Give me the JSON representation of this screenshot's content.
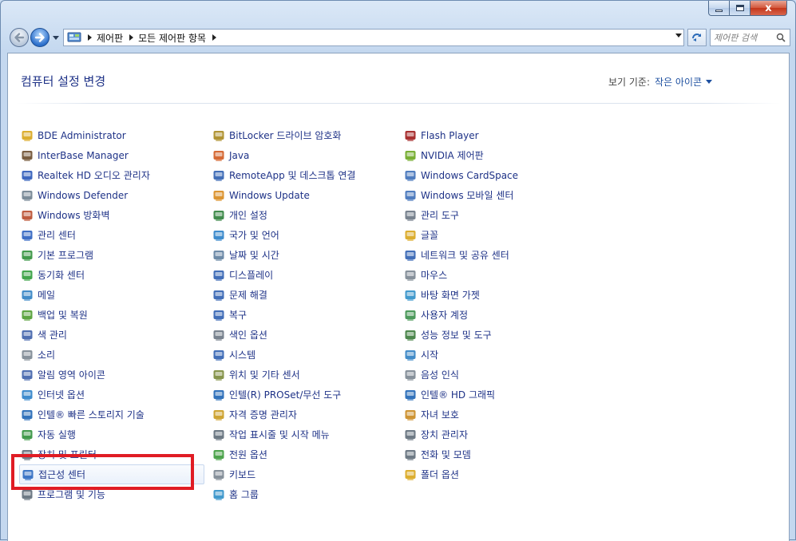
{
  "window": {
    "buttons": {
      "close_glyph": "x"
    }
  },
  "address": {
    "crumbs": [
      "제어판",
      "모든 제어판 항목"
    ],
    "search_placeholder": "제어판 검색"
  },
  "header": {
    "title": "컴퓨터 설정 변경",
    "view_by_label": "보기 기준:",
    "view_by_value": "작은 아이콘"
  },
  "columns": [
    [
      {
        "label": "BDE Administrator",
        "icon": "bde-icon",
        "color": "#d8a51a"
      },
      {
        "label": "InterBase Manager",
        "icon": "interbase-icon",
        "color": "#6b4d2c"
      },
      {
        "label": "Realtek HD 오디오 관리자",
        "icon": "realtek-icon",
        "color": "#2a58b8"
      },
      {
        "label": "Windows Defender",
        "icon": "defender-icon",
        "color": "#6e7f8e"
      },
      {
        "label": "Windows 방화벽",
        "icon": "firewall-icon",
        "color": "#b84a2a"
      },
      {
        "label": "관리 센터",
        "icon": "action-center-icon",
        "color": "#2a5fbf"
      },
      {
        "label": "기본 프로그램",
        "icon": "default-programs-icon",
        "color": "#2f8f3a"
      },
      {
        "label": "동기화 센터",
        "icon": "sync-center-icon",
        "color": "#2f9c3a"
      },
      {
        "label": "메일",
        "icon": "mail-icon",
        "color": "#2f7fc2"
      },
      {
        "label": "백업 및 복원",
        "icon": "backup-icon",
        "color": "#4d9b2f"
      },
      {
        "label": "색 관리",
        "icon": "color-management-icon",
        "color": "#3d5fa8"
      },
      {
        "label": "소리",
        "icon": "sound-icon",
        "color": "#7a8590"
      },
      {
        "label": "알림 영역 아이콘",
        "icon": "notification-icon",
        "color": "#3d5fa8"
      },
      {
        "label": "인터넷 옵션",
        "icon": "internet-options-icon",
        "color": "#2a7fc8"
      },
      {
        "label": "인텔® 빠른 스토리지 기술",
        "icon": "intel-storage-icon",
        "color": "#1d64b4"
      },
      {
        "label": "자동 실행",
        "icon": "autoplay-icon",
        "color": "#2f8f3a"
      },
      {
        "label": "장치 및 프린터",
        "icon": "devices-printers-icon",
        "color": "#5e6b78"
      },
      {
        "label": "접근성 센터",
        "icon": "ease-of-access-icon",
        "color": "#2a68c0",
        "selected": true
      },
      {
        "label": "프로그램 및 기능",
        "icon": "programs-features-icon",
        "color": "#5e6b78"
      }
    ],
    [
      {
        "label": "BitLocker 드라이브 암호화",
        "icon": "bitlocker-icon",
        "color": "#a8881e"
      },
      {
        "label": "Java",
        "icon": "java-icon",
        "color": "#d25a1f"
      },
      {
        "label": "RemoteApp 및 데스크톱 연결",
        "icon": "remoteapp-icon",
        "color": "#2f5fb0"
      },
      {
        "label": "Windows Update",
        "icon": "windows-update-icon",
        "color": "#d88a1c"
      },
      {
        "label": "개인 설정",
        "icon": "personalization-icon",
        "color": "#2d7f3a"
      },
      {
        "label": "국가 및 언어",
        "icon": "region-language-icon",
        "color": "#2a7fc8"
      },
      {
        "label": "날짜 및 시간",
        "icon": "date-time-icon",
        "color": "#5e7e9e"
      },
      {
        "label": "디스플레이",
        "icon": "display-icon",
        "color": "#2f5fb0"
      },
      {
        "label": "문제 해결",
        "icon": "troubleshooting-icon",
        "color": "#2f5fb0"
      },
      {
        "label": "복구",
        "icon": "recovery-icon",
        "color": "#2f5fb0"
      },
      {
        "label": "색인 옵션",
        "icon": "indexing-icon",
        "color": "#6a7683"
      },
      {
        "label": "시스템",
        "icon": "system-icon",
        "color": "#2f5fb0"
      },
      {
        "label": "위치 및 기타 센서",
        "icon": "location-sensors-icon",
        "color": "#7a8a3a"
      },
      {
        "label": "인텔(R) PROSet/무선 도구",
        "icon": "intel-proset-icon",
        "color": "#1d64b4"
      },
      {
        "label": "자격 증명 관리자",
        "icon": "credential-manager-icon",
        "color": "#c99a1e"
      },
      {
        "label": "작업 표시줄 및 시작 메뉴",
        "icon": "taskbar-icon",
        "color": "#5e6b78"
      },
      {
        "label": "전원 옵션",
        "icon": "power-options-icon",
        "color": "#3b9a3a"
      },
      {
        "label": "키보드",
        "icon": "keyboard-icon",
        "color": "#7a8590"
      },
      {
        "label": "홈 그룹",
        "icon": "homegroup-icon",
        "color": "#2f8fc8"
      }
    ],
    [
      {
        "label": "Flash Player",
        "icon": "flash-player-icon",
        "color": "#9e1a1a"
      },
      {
        "label": "NVIDIA 제어판",
        "icon": "nvidia-icon",
        "color": "#6aa61f"
      },
      {
        "label": "Windows CardSpace",
        "icon": "cardspace-icon",
        "color": "#3d6fb8"
      },
      {
        "label": "Windows 모바일 센터",
        "icon": "mobility-center-icon",
        "color": "#3d6fb8"
      },
      {
        "label": "관리 도구",
        "icon": "admin-tools-icon",
        "color": "#6a7683"
      },
      {
        "label": "글꼴",
        "icon": "fonts-icon",
        "color": "#d8a51a"
      },
      {
        "label": "네트워크 및 공유 센터",
        "icon": "network-sharing-icon",
        "color": "#2f5fb0"
      },
      {
        "label": "마우스",
        "icon": "mouse-icon",
        "color": "#7a8590"
      },
      {
        "label": "바탕 화면 가젯",
        "icon": "gadgets-icon",
        "color": "#2f8fc8"
      },
      {
        "label": "사용자 계정",
        "icon": "user-accounts-icon",
        "color": "#3a8f4a"
      },
      {
        "label": "성능 정보 및 도구",
        "icon": "performance-icon",
        "color": "#3a7a3a"
      },
      {
        "label": "시작",
        "icon": "getting-started-icon",
        "color": "#2f7fc2"
      },
      {
        "label": "음성 인식",
        "icon": "speech-recognition-icon",
        "color": "#7a8590"
      },
      {
        "label": "인텔® HD 그래픽",
        "icon": "intel-graphics-icon",
        "color": "#1d64b4"
      },
      {
        "label": "자녀 보호",
        "icon": "parental-controls-icon",
        "color": "#c9881e"
      },
      {
        "label": "장치 관리자",
        "icon": "device-manager-icon",
        "color": "#5e6b78"
      },
      {
        "label": "전화 및 모뎀",
        "icon": "phone-modem-icon",
        "color": "#5e6b78"
      },
      {
        "label": "폴더 옵션",
        "icon": "folder-options-icon",
        "color": "#d8a51a"
      }
    ]
  ]
}
